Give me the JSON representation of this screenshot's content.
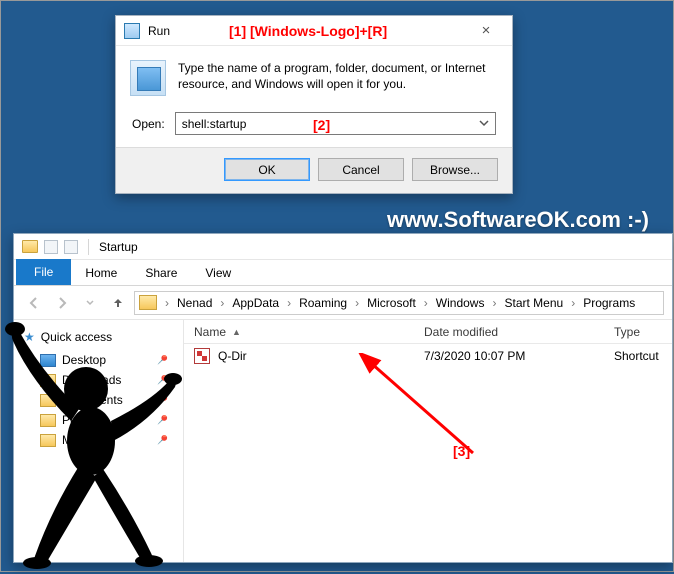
{
  "annotations": {
    "a1": "[1] [Windows-Logo]+[R]",
    "a2": "[2]",
    "a3": "[3]"
  },
  "watermark": "www.SoftwareOK.com :-)",
  "run": {
    "title": "Run",
    "description": "Type the name of a program, folder, document, or Internet resource, and Windows will open it for you.",
    "open_label": "Open:",
    "value": "shell:startup",
    "ok": "OK",
    "cancel": "Cancel",
    "browse": "Browse..."
  },
  "explorer": {
    "title": "Startup",
    "tabs": {
      "file": "File",
      "home": "Home",
      "share": "Share",
      "view": "View"
    },
    "breadcrumbs": [
      "Nenad",
      "AppData",
      "Roaming",
      "Microsoft",
      "Windows",
      "Start Menu",
      "Programs"
    ],
    "nav": {
      "quick": "Quick access",
      "items": [
        "Desktop",
        "Downloads",
        "Documents",
        "Pictures",
        "Music"
      ]
    },
    "columns": {
      "name": "Name",
      "date": "Date modified",
      "type": "Type"
    },
    "rows": [
      {
        "name": "Q-Dir",
        "date": "7/3/2020 10:07 PM",
        "type": "Shortcut"
      }
    ]
  }
}
